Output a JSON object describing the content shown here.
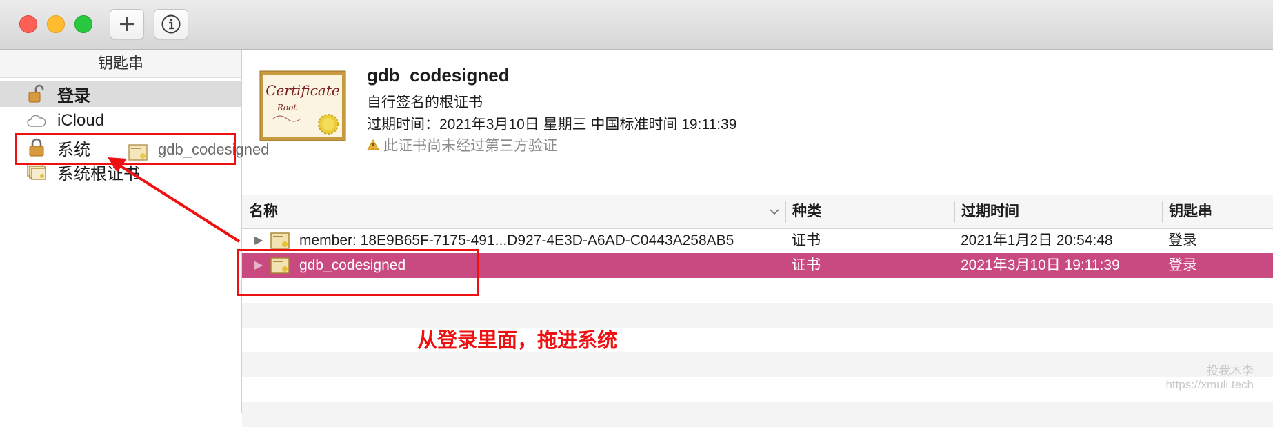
{
  "toolbar": {
    "add_icon": "plus-icon",
    "info_icon": "info-icon"
  },
  "sidebar": {
    "header": "钥匙串",
    "items": [
      {
        "label": "登录",
        "icon": "lock-open-icon"
      },
      {
        "label": "iCloud",
        "icon": "cloud-icon"
      },
      {
        "label": "系统",
        "icon": "lock-icon"
      },
      {
        "label": "系统根证书",
        "icon": "certificates-icon"
      }
    ]
  },
  "info": {
    "title": "gdb_codesigned",
    "subtitle": "自行签名的根证书",
    "expiry": "过期时间：2021年3月10日 星期三 中国标准时间 19:11:39",
    "warning": "此证书尚未经过第三方验证"
  },
  "table": {
    "columns": [
      "名称",
      "种类",
      "过期时间",
      "钥匙串"
    ],
    "rows": [
      {
        "name": "member: 18E9B65F-7175-491...D927-4E3D-A6AD-C0443A258AB5",
        "kind": "证书",
        "expires": "2021年1月2日 20:54:48",
        "keychain": "登录"
      },
      {
        "name": "gdb_codesigned",
        "kind": "证书",
        "expires": "2021年3月10日 19:11:39",
        "keychain": "登录"
      }
    ]
  },
  "drag_ghost": {
    "label": "gdb_codesigned"
  },
  "annotation": {
    "text": "从登录里面，拖进系统",
    "color": "#ee1111"
  },
  "watermark": {
    "line1": "投我木李",
    "line2": "https://xmuli.tech"
  },
  "colors": {
    "selection": "#c94a80",
    "annotation": "#ee1111"
  }
}
